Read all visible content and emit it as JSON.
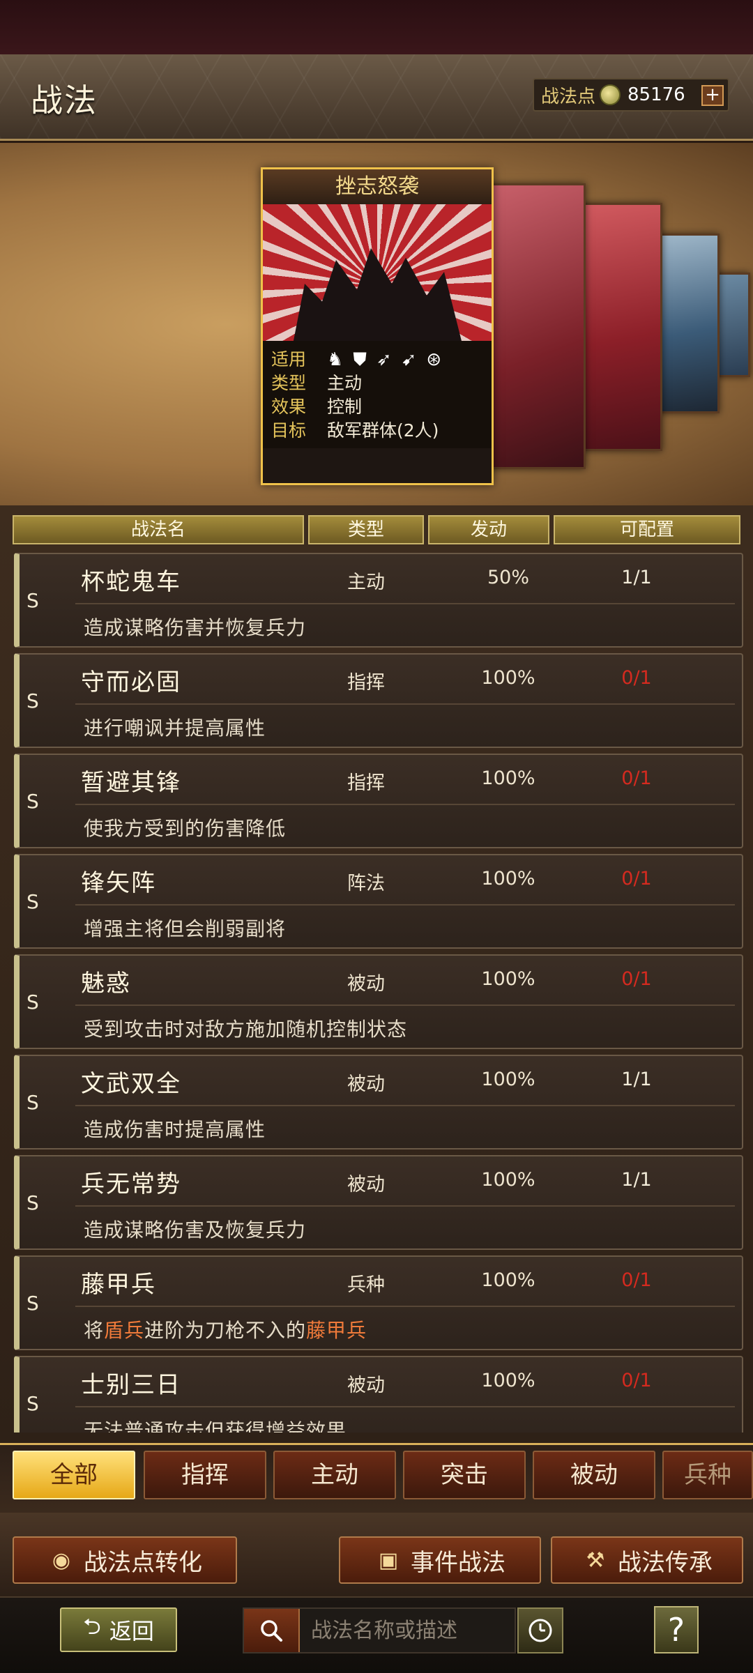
{
  "header": {
    "title": "战法",
    "points_label": "战法点",
    "points_value": "85176",
    "plus_symbol": "+"
  },
  "featured_card": {
    "name": "挫志怒袭",
    "applicable_label": "适用",
    "type_label": "类型",
    "type_value": "主动",
    "effect_label": "效果",
    "effect_value": "控制",
    "target_label": "目标",
    "target_value": "敌军群体(2人)",
    "class_icons": [
      "cavalry-icon",
      "shield-icon",
      "bow-icon",
      "spear-icon",
      "wheel-icon"
    ]
  },
  "table": {
    "columns": [
      "战法名",
      "类型",
      "发动",
      "可配置"
    ],
    "rows": [
      {
        "grade": "S",
        "name": "杯蛇鬼车",
        "type": "主动",
        "rate": "50%",
        "config": "1/1",
        "config_red": false,
        "desc": "造成谋略伤害并恢复兵力"
      },
      {
        "grade": "S",
        "name": "守而必固",
        "type": "指挥",
        "rate": "100%",
        "config": "0/1",
        "config_red": true,
        "desc": "进行嘲讽并提高属性"
      },
      {
        "grade": "S",
        "name": "暂避其锋",
        "type": "指挥",
        "rate": "100%",
        "config": "0/1",
        "config_red": true,
        "desc": "使我方受到的伤害降低"
      },
      {
        "grade": "S",
        "name": "锋矢阵",
        "type": "阵法",
        "rate": "100%",
        "config": "0/1",
        "config_red": true,
        "desc": "增强主将但会削弱副将"
      },
      {
        "grade": "S",
        "name": "魅惑",
        "type": "被动",
        "rate": "100%",
        "config": "0/1",
        "config_red": true,
        "desc": "受到攻击时对敌方施加随机控制状态"
      },
      {
        "grade": "S",
        "name": "文武双全",
        "type": "被动",
        "rate": "100%",
        "config": "1/1",
        "config_red": false,
        "desc": "造成伤害时提高属性"
      },
      {
        "grade": "S",
        "name": "兵无常势",
        "type": "被动",
        "rate": "100%",
        "config": "1/1",
        "config_red": false,
        "desc": "造成谋略伤害及恢复兵力"
      },
      {
        "grade": "S",
        "name": "藤甲兵",
        "type": "兵种",
        "rate": "100%",
        "config": "0/1",
        "config_red": true,
        "desc_parts": [
          "将",
          "盾兵",
          "进阶为刀枪不入的",
          "藤甲兵"
        ]
      },
      {
        "grade": "S",
        "name": "士别三日",
        "type": "被动",
        "rate": "100%",
        "config": "0/1",
        "config_red": true,
        "desc": "无法普通攻击但获得增益效果"
      }
    ]
  },
  "filters": [
    "全部",
    "指挥",
    "主动",
    "突击",
    "被动",
    "兵种"
  ],
  "actions": {
    "convert": "战法点转化",
    "event": "事件战法",
    "inherit": "战法传承"
  },
  "bottom": {
    "back": "返回",
    "search_placeholder": "战法名称或描述",
    "help": "?"
  },
  "colors": {
    "accent_gold": "#f0c24a",
    "config_red": "#d42a1f",
    "highlight_orange": "#f07a3a"
  }
}
